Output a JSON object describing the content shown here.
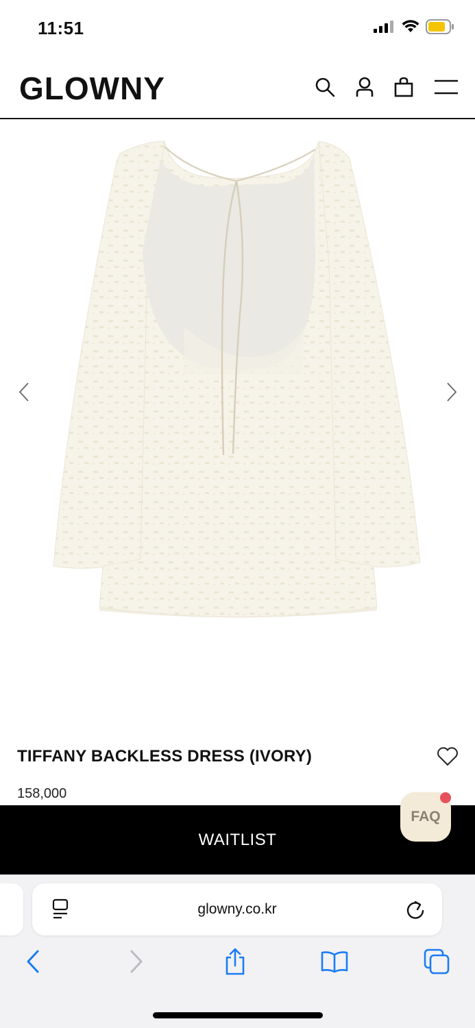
{
  "status_bar": {
    "time": "11:51"
  },
  "header": {
    "logo": "GLOWNY",
    "icons": [
      "search-icon",
      "account-icon",
      "shopping-bag-icon",
      "menu-icon"
    ]
  },
  "gallery": {
    "image_alt": "ivory backless dress with long flared sheer sleeves",
    "prev_icon": "chevron-left-icon",
    "next_icon": "chevron-right-icon"
  },
  "product": {
    "name": "TIFFANY BACKLESS DRESS (IVORY)",
    "price": "158,000",
    "wishlist_icon": "heart-icon"
  },
  "cta": {
    "label": "WAITLIST"
  },
  "faq": {
    "label": "FAQ",
    "badge_color": "#e8505b"
  },
  "browser": {
    "url": "glowny.co.kr",
    "toolbar": [
      "back-icon",
      "forward-icon",
      "share-icon",
      "bookmarks-icon",
      "tabs-icon"
    ],
    "accent_color": "#1a7cf5"
  }
}
